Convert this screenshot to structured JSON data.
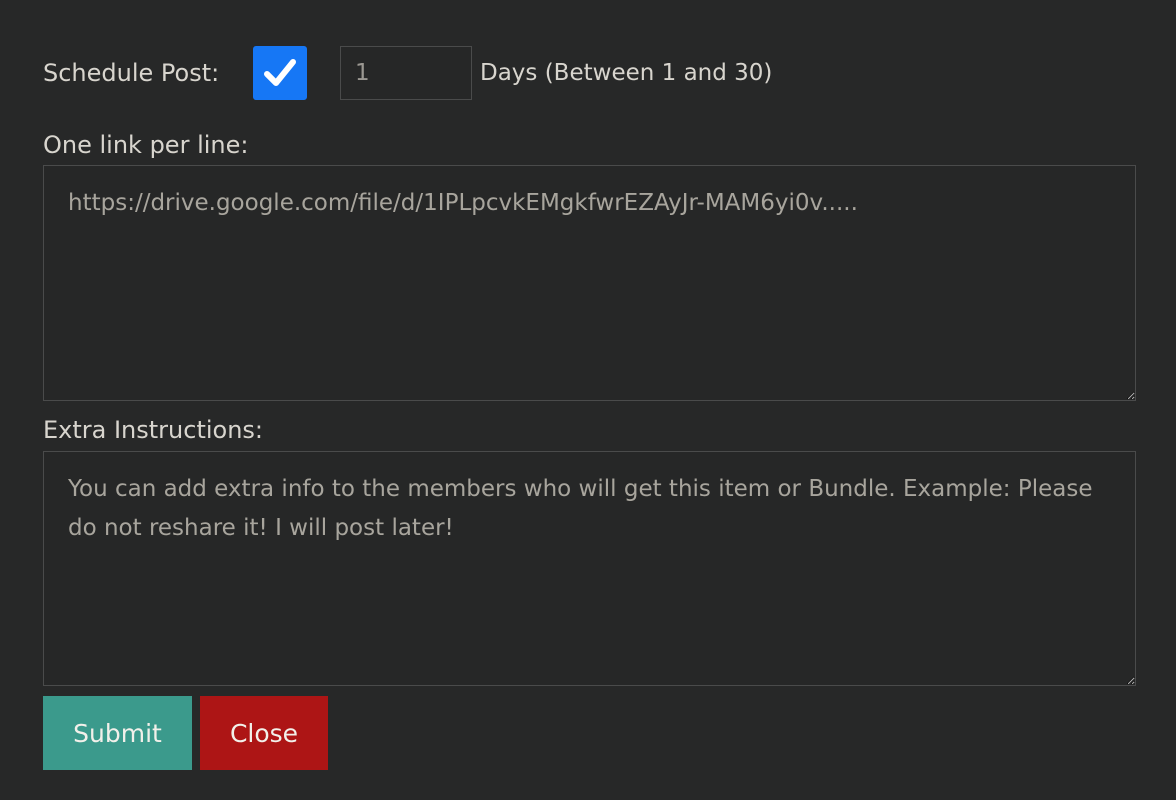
{
  "schedule": {
    "label": "Schedule Post:",
    "checked": true,
    "days_value": "1",
    "days_hint": "Days (Between 1 and 30)"
  },
  "links": {
    "label": "One link per line:",
    "value": "https://drive.google.com/file/d/1IPLpcvkEMgkfwrEZAyJr-MAM6yi0v....."
  },
  "instructions": {
    "label": "Extra Instructions:",
    "placeholder": "You can add extra info to the members who will get this item or Bundle. Example: Please do not reshare it! I will post later!"
  },
  "buttons": {
    "submit": "Submit",
    "close": "Close"
  },
  "colors": {
    "background": "#272828",
    "checkbox": "#1677f5",
    "submit": "#3b9a8c",
    "close": "#ad1515"
  }
}
